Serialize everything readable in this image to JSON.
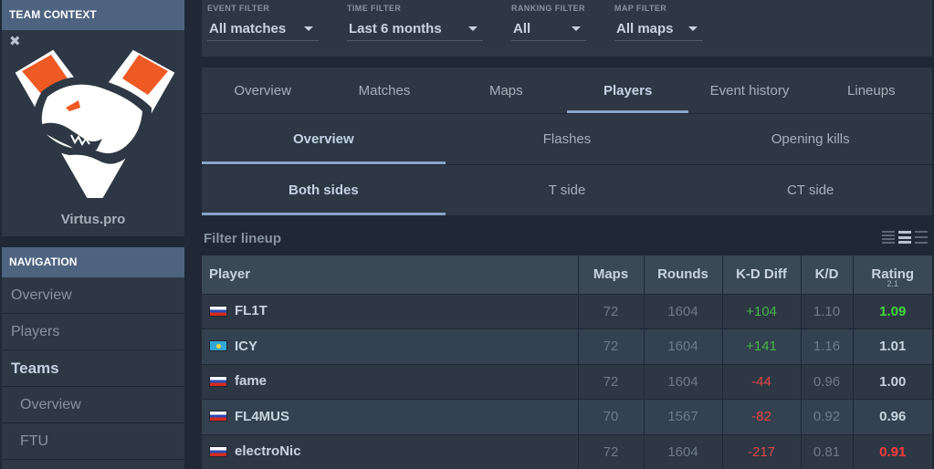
{
  "sidebar": {
    "team_context_title": "TEAM CONTEXT",
    "team_name": "Virtus.pro",
    "close_icon": "close-icon",
    "navigation_title": "NAVIGATION",
    "nav_items": [
      {
        "label": "Overview"
      },
      {
        "label": "Players"
      },
      {
        "label": "Teams"
      },
      {
        "label": "Overview"
      },
      {
        "label": "FTU"
      }
    ]
  },
  "filters": {
    "event": {
      "label": "EVENT FILTER",
      "value": "All matches"
    },
    "time": {
      "label": "TIME FILTER",
      "value": "Last 6 months"
    },
    "ranking": {
      "label": "RANKING FILTER",
      "value": "All"
    },
    "map": {
      "label": "MAP FILTER",
      "value": "All maps"
    }
  },
  "tabs": {
    "main": [
      "Overview",
      "Matches",
      "Maps",
      "Players",
      "Event history",
      "Lineups"
    ],
    "main_active": "Players",
    "sub1": [
      "Overview",
      "Flashes",
      "Opening kills"
    ],
    "sub1_active": "Overview",
    "sub2": [
      "Both sides",
      "T side",
      "CT side"
    ],
    "sub2_active": "Both sides"
  },
  "lineup": {
    "label": "Filter lineup",
    "view_icons": [
      "compact-view-icon",
      "list-view-icon",
      "expanded-view-icon"
    ]
  },
  "table": {
    "headers": {
      "player": "Player",
      "maps": "Maps",
      "rounds": "Rounds",
      "kd_diff": "K-D Diff",
      "kd": "K/D",
      "rating": "Rating",
      "rating_version": "2.1"
    },
    "rows": [
      {
        "flag": "ru",
        "player": "FL1T",
        "maps": "72",
        "rounds": "1604",
        "kd_diff": "+104",
        "kd": "1.10",
        "rating": "1.09"
      },
      {
        "flag": "kz",
        "player": "ICY",
        "maps": "72",
        "rounds": "1604",
        "kd_diff": "+141",
        "kd": "1.16",
        "rating": "1.01"
      },
      {
        "flag": "ru",
        "player": "fame",
        "maps": "72",
        "rounds": "1604",
        "kd_diff": "-44",
        "kd": "0.96",
        "rating": "1.00"
      },
      {
        "flag": "ru",
        "player": "FL4MUS",
        "maps": "70",
        "rounds": "1567",
        "kd_diff": "-82",
        "kd": "0.92",
        "rating": "0.96"
      },
      {
        "flag": "ru",
        "player": "electroNic",
        "maps": "72",
        "rounds": "1604",
        "kd_diff": "-217",
        "kd": "0.81",
        "rating": "0.91"
      }
    ]
  },
  "colors": {
    "accent": "#8aa4c8",
    "positive": "#45b646",
    "negative": "#e04444",
    "rating_good": "#45d63d",
    "rating_bad": "#ff3b3b",
    "logo_orange": "#ef5a24"
  }
}
